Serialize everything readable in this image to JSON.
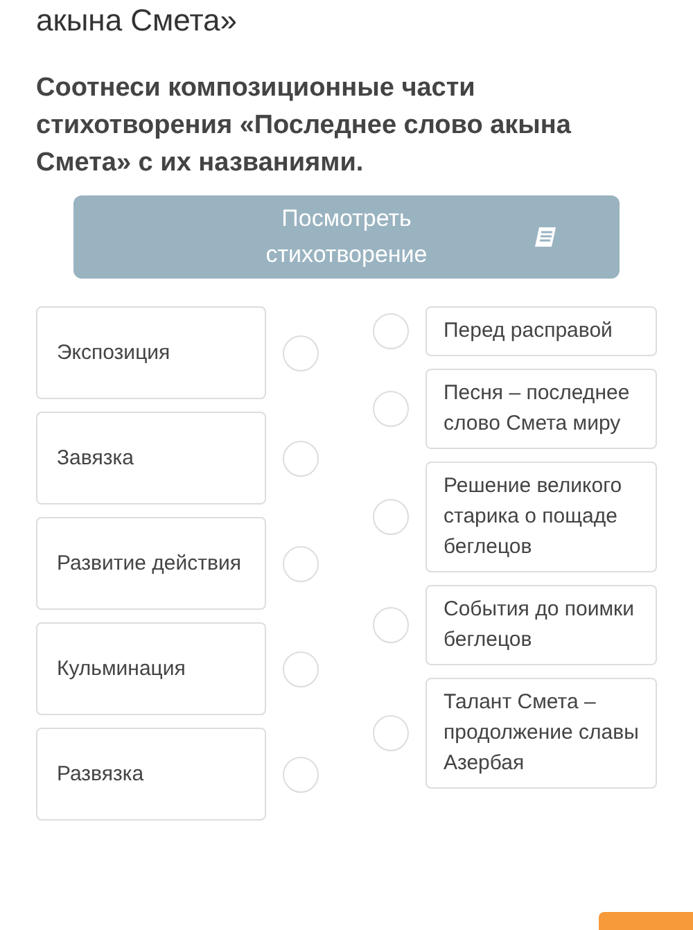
{
  "heading": "акына Смета»",
  "question": "Соотнеси композиционные части стихотворения «Последнее слово акына Смета» с их названиями.",
  "poem_button": {
    "label": "Посмотреть стихотворение"
  },
  "left_items": [
    {
      "text": "Экспозиция",
      "selected": false
    },
    {
      "text": "Завязка",
      "selected": false
    },
    {
      "text": "Развитие действия",
      "selected": false
    },
    {
      "text": "Кульминация",
      "selected": false
    },
    {
      "text": "Развязка",
      "selected": false
    }
  ],
  "right_items": [
    {
      "text": "Перед расправой",
      "selected": false
    },
    {
      "text": "Песня – последнее слово Смета миру",
      "selected": false
    },
    {
      "text": "Решение великого старика о пощаде беглецов",
      "selected": false
    },
    {
      "text": "События до поимки беглецов",
      "selected": false
    },
    {
      "text": "Талант Смета – продолжение славы Азербая",
      "selected": false
    }
  ]
}
